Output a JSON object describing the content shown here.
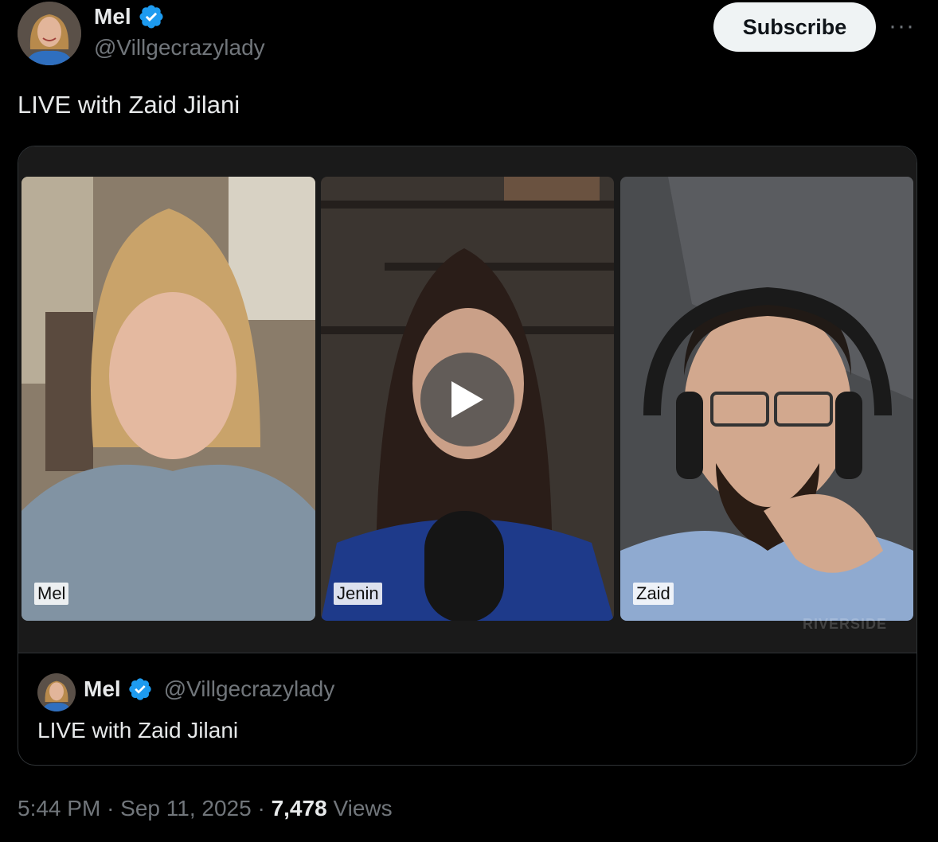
{
  "author": {
    "name": "Mel",
    "handle": "@Villgecrazylady",
    "verified_icon": "verified-badge-icon",
    "badge_color": "#1d9bf0"
  },
  "actions": {
    "subscribe_label": "Subscribe",
    "more_label": "···"
  },
  "tweet": {
    "text": "LIVE with Zaid Jilani"
  },
  "video": {
    "participants": [
      {
        "label": "Mel"
      },
      {
        "label": "Jenin"
      },
      {
        "label": "Zaid"
      }
    ],
    "watermark": "RIVERSIDE",
    "play_icon": "play-icon"
  },
  "quoted": {
    "name": "Mel",
    "handle": "@Villgecrazylady",
    "text": "LIVE with Zaid Jilani"
  },
  "meta": {
    "time": "5:44 PM",
    "separator": "·",
    "date": "Sep 11, 2025",
    "views_count": "7,478",
    "views_label": "Views"
  }
}
